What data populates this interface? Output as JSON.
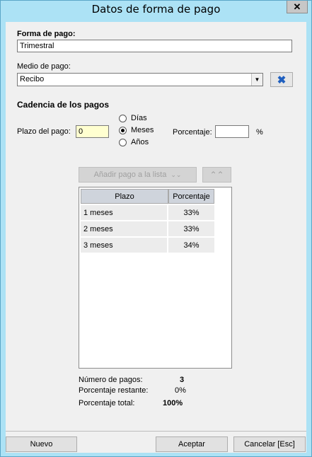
{
  "window": {
    "title": "Datos de forma de pago",
    "close_glyph": "✕"
  },
  "forma_pago": {
    "label": "Forma de pago:",
    "value": "Trimestral"
  },
  "medio_pago": {
    "label": "Medio de pago:",
    "value": "Recibo",
    "clear_icon": "clear-icon"
  },
  "cadencia": {
    "heading": "Cadencia de los pagos",
    "plazo_label": "Plazo del pago:",
    "plazo_value": "0",
    "units": [
      {
        "label": "Días",
        "checked": false
      },
      {
        "label": "Meses",
        "checked": true
      },
      {
        "label": "Años",
        "checked": false
      }
    ],
    "porcentaje_label": "Porcentaje:",
    "porcentaje_value": "",
    "percent_sign": "%"
  },
  "actions": {
    "add_label": "Añadir pago a la lista",
    "add_icon": "double-chevron-down-icon",
    "remove_icon": "double-chevron-up-icon"
  },
  "table": {
    "columns": [
      "Plazo",
      "Porcentaje"
    ],
    "rows": [
      {
        "plazo": "1 meses",
        "porcentaje": "33%"
      },
      {
        "plazo": "2 meses",
        "porcentaje": "33%"
      },
      {
        "plazo": "3 meses",
        "porcentaje": "34%"
      }
    ]
  },
  "summary": {
    "numero_label": "Número de pagos:",
    "numero_value": "3",
    "restante_label": "Porcentaje restante:",
    "restante_value": "0%",
    "total_label": "Porcentaje total:",
    "total_value": "100%"
  },
  "footer": {
    "nuevo": "Nuevo",
    "aceptar": "Aceptar",
    "cancelar": "Cancelar [Esc]"
  }
}
